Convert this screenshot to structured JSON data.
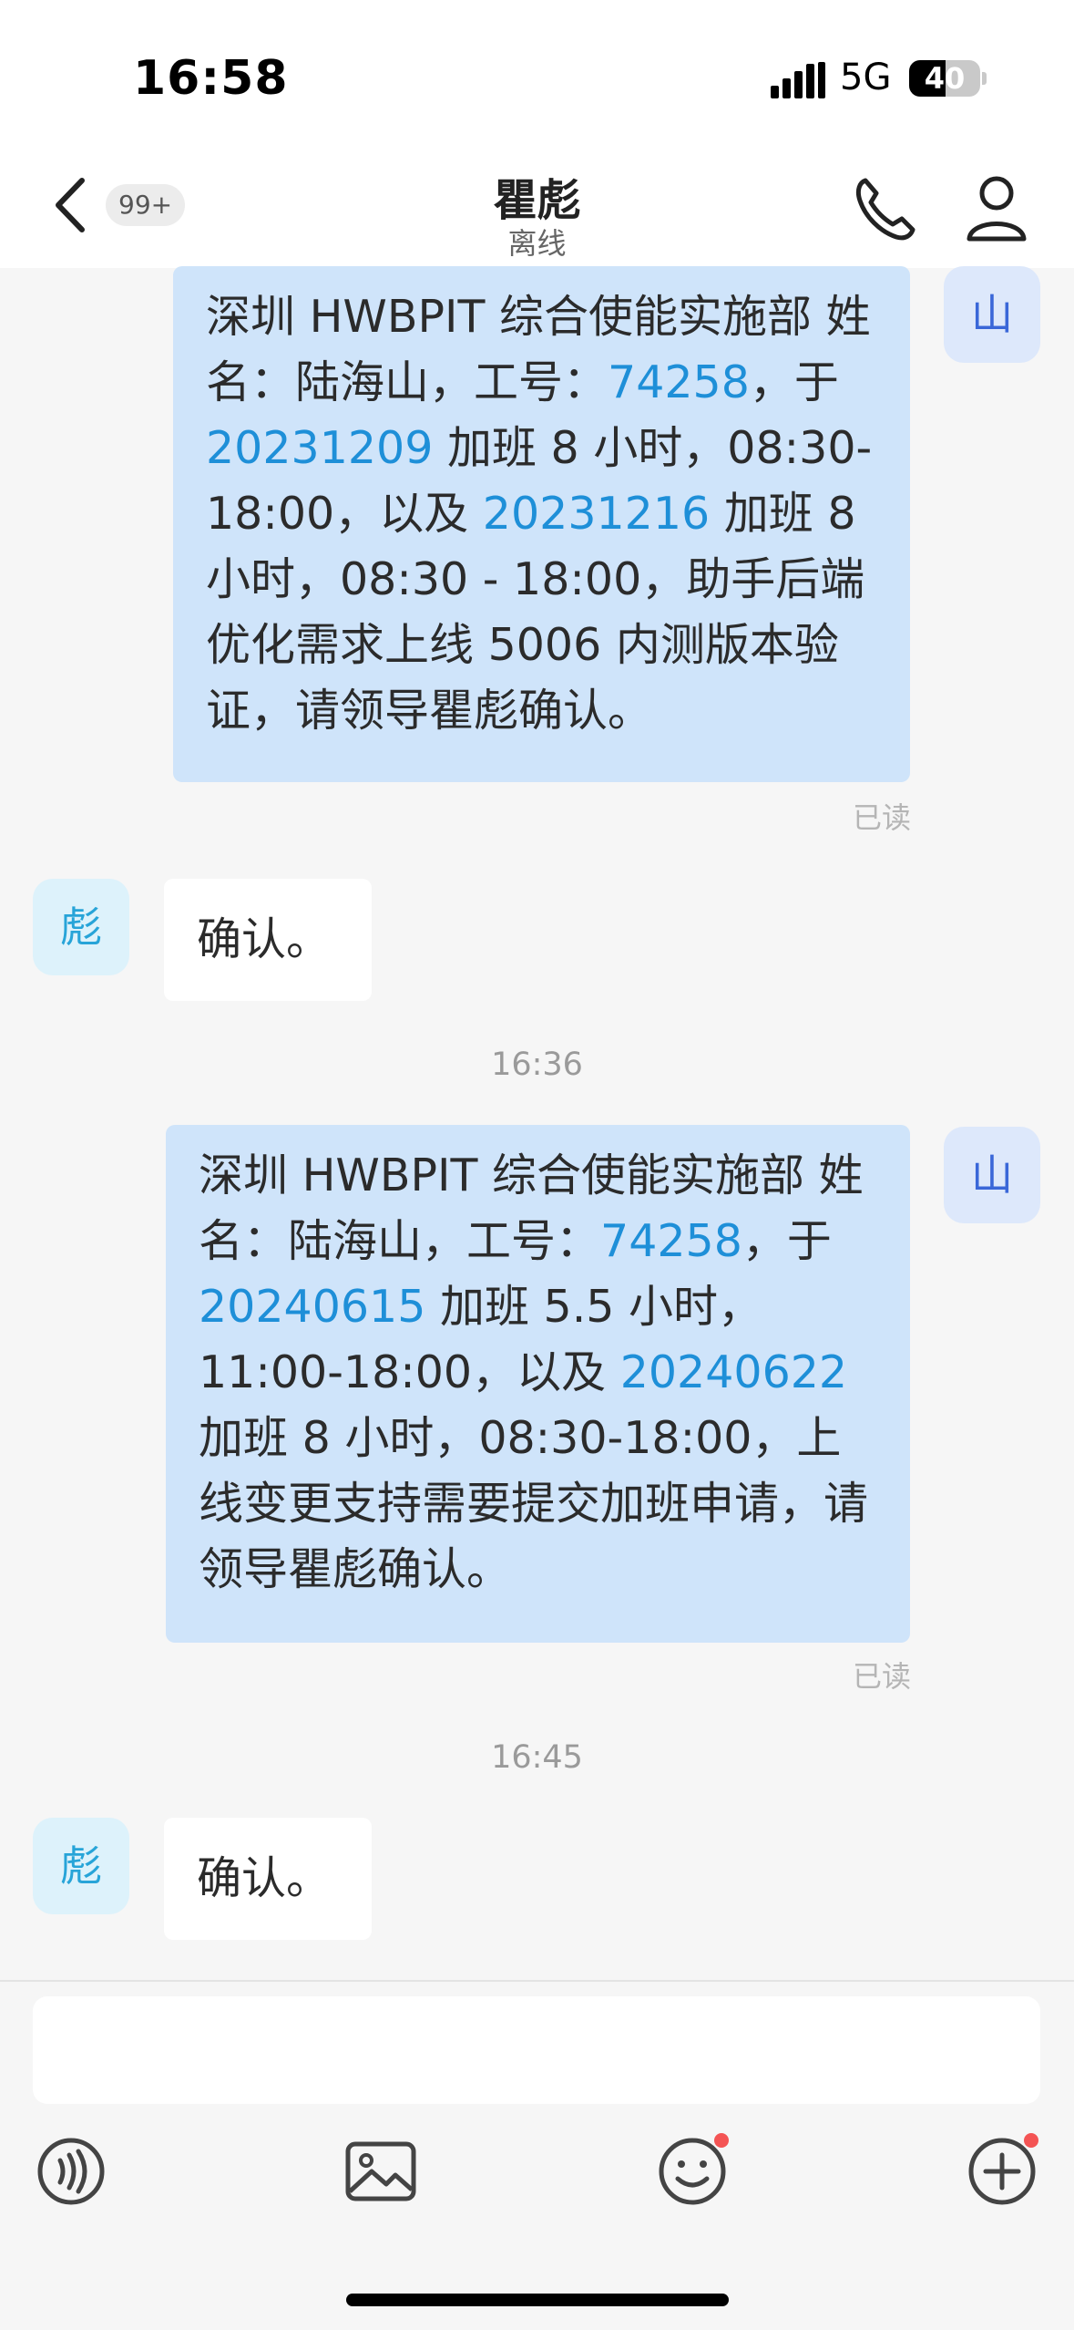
{
  "status_bar": {
    "time": "16:58",
    "network": "5G",
    "battery": "40"
  },
  "header": {
    "unread_count": "99+",
    "title": "瞿彪",
    "status": "离线"
  },
  "messages": [
    {
      "sender": "self",
      "avatar": "山",
      "segments": [
        "深圳 HWBPIT 综合使能实施部 姓名：陆海山，工号：",
        "74258",
        "，于 ",
        "20231209",
        " 加班 8 小时，08:30-18:00，以及 ",
        "20231216",
        " 加班 8 小时，08:30 - 18:00，助手后端优化需求上线 5006 内测版本验证，请领导瞿彪确认。"
      ],
      "read_label": "已读"
    },
    {
      "sender": "peer",
      "avatar": "彪",
      "text": "确认。"
    },
    {
      "timestamp": "16:36"
    },
    {
      "sender": "self",
      "avatar": "山",
      "segments": [
        "深圳 HWBPIT 综合使能实施部 姓名：陆海山，工号：",
        "74258",
        "，于 ",
        "20240615",
        " 加班 5.5 小时，11:00-18:00，以及 ",
        "20240622",
        " 加班 8 小时，08:30-18:00，上线变更支持需要提交加班申请，请领导瞿彪确认。"
      ],
      "read_label": "已读"
    },
    {
      "timestamp": "16:45"
    },
    {
      "sender": "peer",
      "avatar": "彪",
      "text": "确认。"
    }
  ],
  "input": {
    "placeholder": ""
  },
  "toolbar": {
    "icons": [
      "voice-icon",
      "image-icon",
      "emoji-icon",
      "plus-icon"
    ]
  },
  "colors": {
    "outgoing_bubble": "#cfe4fa",
    "incoming_bubble": "#ffffff",
    "link": "#1e8fd8",
    "badge_dot": "#f45454"
  }
}
